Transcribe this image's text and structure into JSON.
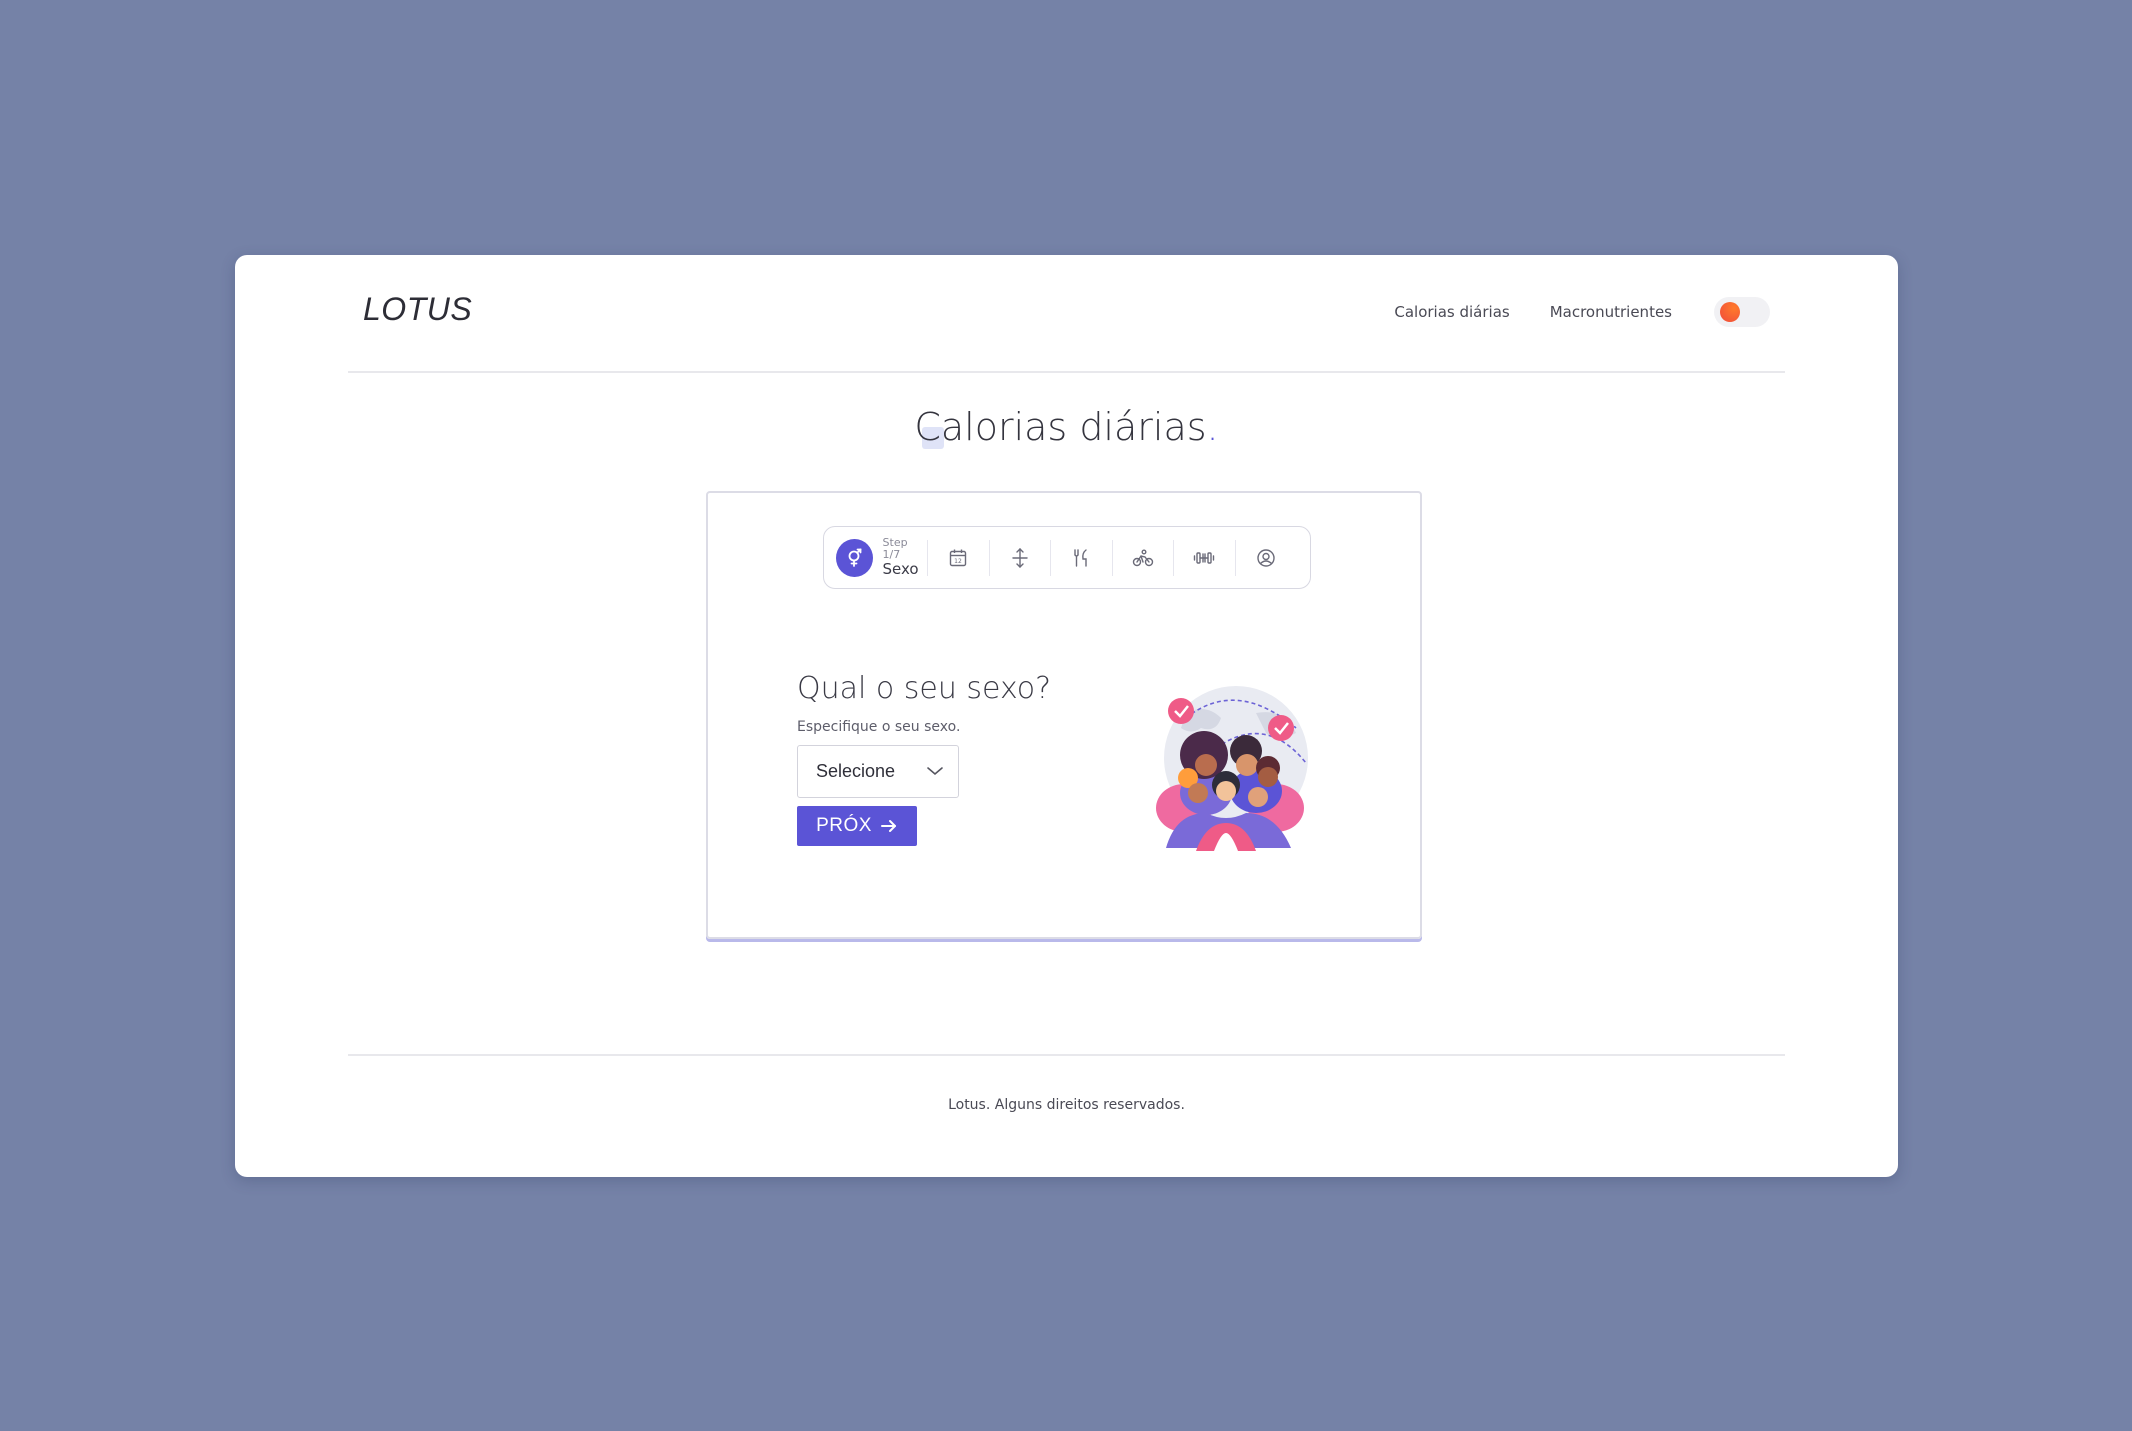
{
  "header": {
    "logo": "LOTUS",
    "nav": [
      "Calorias diárias",
      "Macronutrientes"
    ]
  },
  "page": {
    "title": "Calorias diárias",
    "title_dot": "."
  },
  "stepper": {
    "active_step_count": "Step 1/7",
    "active_step_label": "Sexo",
    "steps_icons": [
      "gender-icon",
      "calendar-icon",
      "height-icon",
      "fork-knife-icon",
      "activity-icon",
      "dumbbell-icon",
      "user-icon"
    ]
  },
  "form": {
    "question": "Qual o seu sexo?",
    "helper": "Especifique o seu sexo.",
    "select_value": "Selecione",
    "next_label": "PRÓX"
  },
  "footer": {
    "text": "Lotus. Alguns direitos reservados."
  },
  "colors": {
    "background": "#7582a7",
    "accent": "#5b54d6",
    "toggle_knob": "#f04a3c"
  }
}
